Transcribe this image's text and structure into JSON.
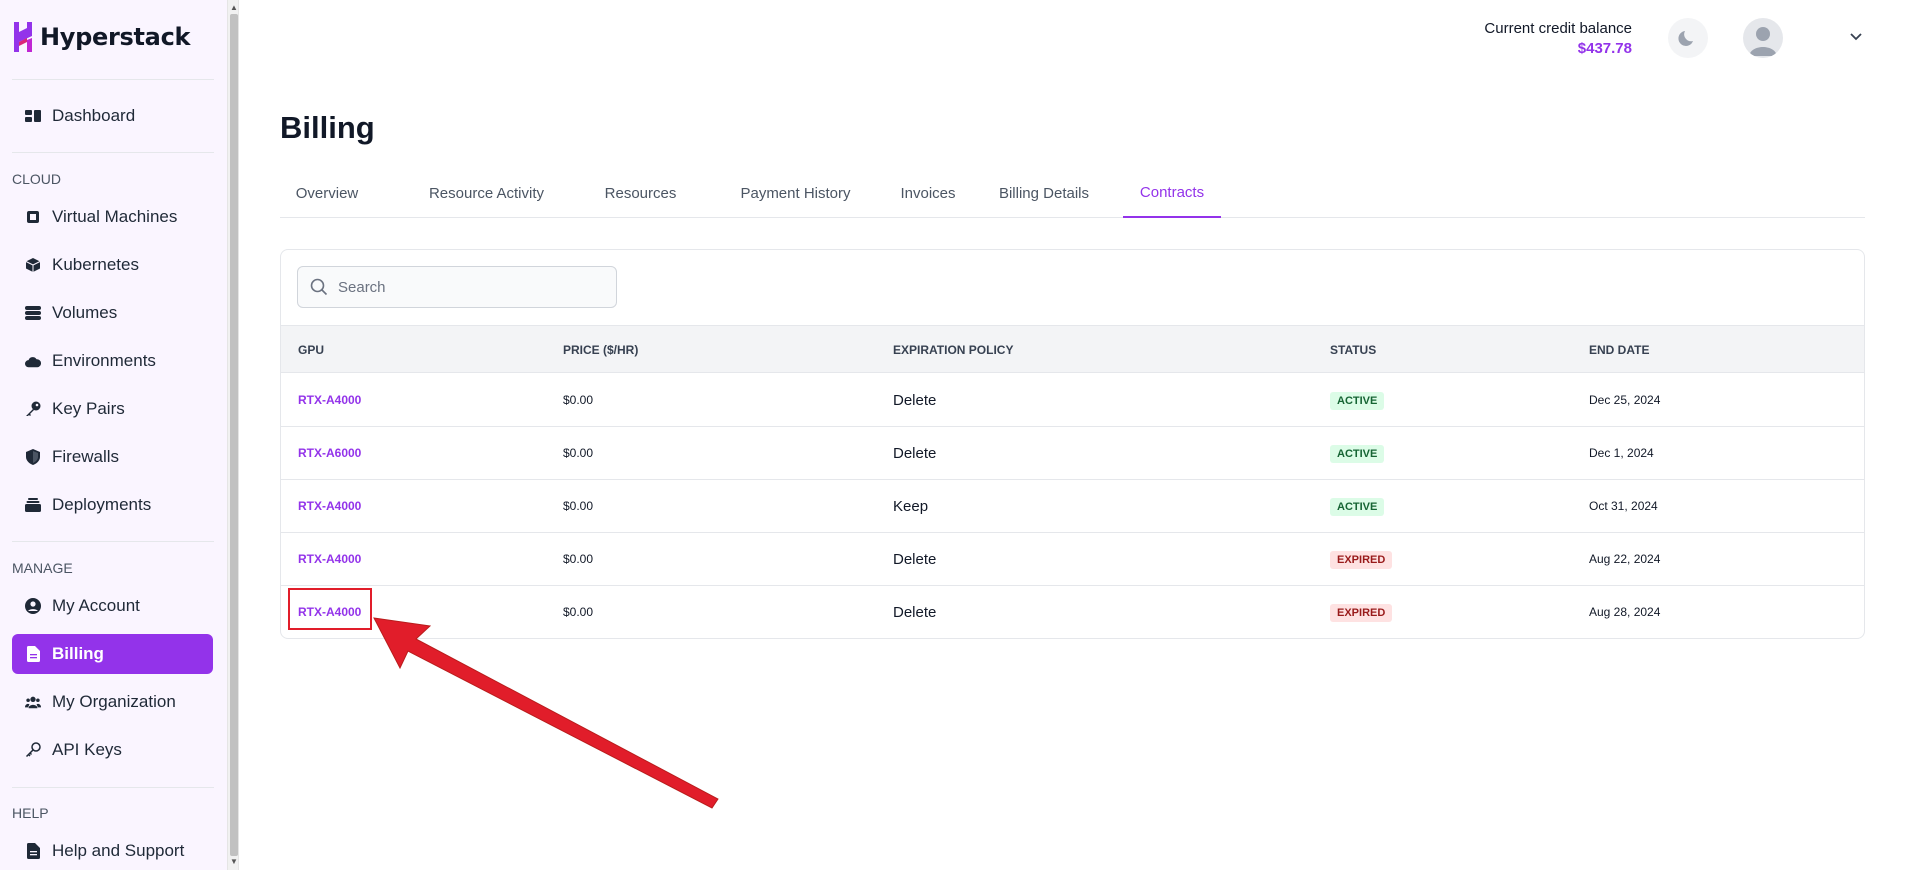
{
  "app": {
    "name": "Hyperstack"
  },
  "sidebar": {
    "top_items": [
      {
        "label": "Dashboard",
        "icon": "dashboard-icon"
      }
    ],
    "sections": [
      {
        "label": "CLOUD",
        "items": [
          {
            "label": "Virtual Machines",
            "icon": "chip-icon"
          },
          {
            "label": "Kubernetes",
            "icon": "cube-icon"
          },
          {
            "label": "Volumes",
            "icon": "database-icon"
          },
          {
            "label": "Environments",
            "icon": "cloud-icon"
          },
          {
            "label": "Key Pairs",
            "icon": "key-icon"
          },
          {
            "label": "Firewalls",
            "icon": "shield-icon"
          },
          {
            "label": "Deployments",
            "icon": "layers-icon"
          }
        ]
      },
      {
        "label": "MANAGE",
        "items": [
          {
            "label": "My Account",
            "icon": "user-circle-icon"
          },
          {
            "label": "Billing",
            "icon": "file-icon",
            "active": true
          },
          {
            "label": "My Organization",
            "icon": "users-icon"
          },
          {
            "label": "API Keys",
            "icon": "key-outline-icon"
          }
        ]
      },
      {
        "label": "HELP",
        "items": [
          {
            "label": "Help and Support",
            "icon": "file-icon"
          }
        ]
      }
    ]
  },
  "header": {
    "credit_label": "Current credit balance",
    "credit_value": "$437.78"
  },
  "page": {
    "title": "Billing"
  },
  "tabs": [
    {
      "label": "Overview"
    },
    {
      "label": "Resource Activity"
    },
    {
      "label": "Resources"
    },
    {
      "label": "Payment History"
    },
    {
      "label": "Invoices"
    },
    {
      "label": "Billing Details"
    },
    {
      "label": "Contracts",
      "active": true
    }
  ],
  "search": {
    "placeholder": "Search"
  },
  "table": {
    "columns": [
      "GPU",
      "PRICE ($/HR)",
      "EXPIRATION POLICY",
      "STATUS",
      "END DATE"
    ],
    "rows": [
      {
        "gpu": "RTX-A4000",
        "price": "$0.00",
        "policy": "Delete",
        "status": "ACTIVE",
        "end_date": "Dec 25, 2024"
      },
      {
        "gpu": "RTX-A6000",
        "price": "$0.00",
        "policy": "Delete",
        "status": "ACTIVE",
        "end_date": "Dec 1, 2024"
      },
      {
        "gpu": "RTX-A4000",
        "price": "$0.00",
        "policy": "Keep",
        "status": "ACTIVE",
        "end_date": "Oct 31, 2024"
      },
      {
        "gpu": "RTX-A4000",
        "price": "$0.00",
        "policy": "Delete",
        "status": "EXPIRED",
        "end_date": "Aug 22, 2024"
      },
      {
        "gpu": "RTX-A4000",
        "price": "$0.00",
        "policy": "Delete",
        "status": "EXPIRED",
        "end_date": "Aug 28, 2024"
      }
    ]
  },
  "colors": {
    "accent": "#9333ea",
    "active_badge_bg": "#dcfce7",
    "active_badge_text": "#166534",
    "expired_badge_bg": "#fee2e2",
    "expired_badge_text": "#991b1b",
    "annotation": "#e11d2a"
  }
}
